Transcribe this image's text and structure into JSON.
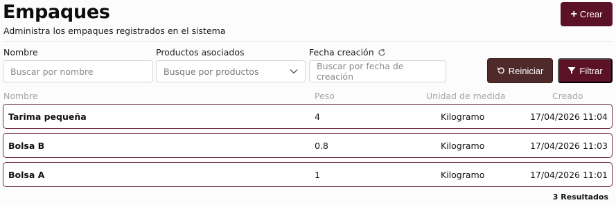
{
  "header": {
    "title": "Empaques",
    "subtitle": "Administra los empaques registrados en el sistema",
    "create_button": "Crear",
    "create_icon": "plus-icon"
  },
  "filters": {
    "name": {
      "label": "Nombre",
      "placeholder": "Buscar por nombre",
      "value": ""
    },
    "products": {
      "label": "Productos asociados",
      "placeholder": "Busque por productos",
      "selected": "Busque por productos",
      "icon": "chevron-down-icon"
    },
    "date": {
      "label": "Fecha creación",
      "placeholder": "Buscar por fecha de creación",
      "value": "",
      "icon": "refresh-icon"
    },
    "reset_button": "Reiniciar",
    "reset_icon": "undo-icon",
    "filter_button": "Filtrar",
    "filter_icon": "funnel-icon"
  },
  "table": {
    "columns": [
      "Nombre",
      "Peso",
      "Unidad de medida",
      "Creado"
    ],
    "rows": [
      {
        "name": "Tarima pequeña",
        "weight": "4",
        "unit": "Kilogramo",
        "created": "17/04/2026 11:04"
      },
      {
        "name": "Bolsa B",
        "weight": "0.8",
        "unit": "Kilogramo",
        "created": "17/04/2026 11:03"
      },
      {
        "name": "Bolsa A",
        "weight": "1",
        "unit": "Kilogramo",
        "created": "17/04/2026 11:01"
      }
    ],
    "results_label": "3 Resultados"
  },
  "colors": {
    "primary": "#5c1226",
    "secondary": "#4e2a2b",
    "row_border": "#6b2a3a"
  }
}
